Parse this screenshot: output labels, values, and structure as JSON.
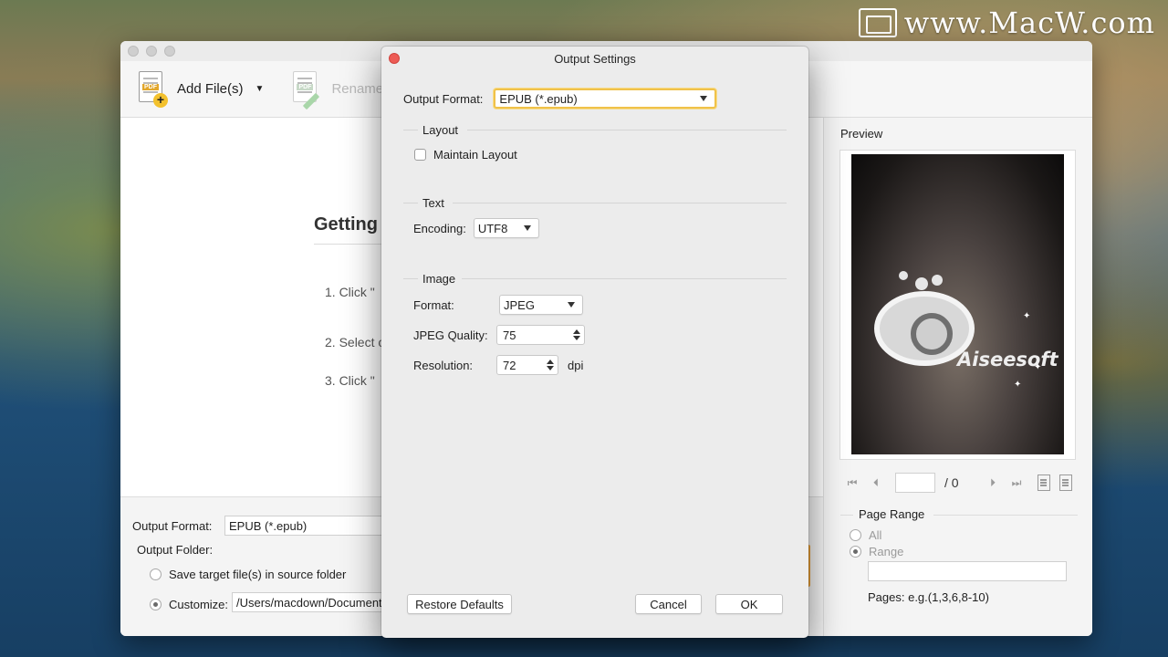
{
  "watermark": {
    "text": "www.MacW.com"
  },
  "toolbar": {
    "add_files_label": "Add File(s)",
    "rename_label": "Rename",
    "pdf_tag": "PDF"
  },
  "main": {
    "getting_started": "Getting",
    "steps": [
      "1. Click \"",
      "2. Select o",
      "3. Click \""
    ]
  },
  "bottom": {
    "output_format_label": "Output Format:",
    "output_format_value": "EPUB (*.epub)",
    "output_folder_label": "Output Folder:",
    "save_source_label": "Save target file(s) in source folder",
    "customize_label": "Customize:",
    "customize_path": "/Users/macdown/Documents"
  },
  "preview": {
    "title": "Preview",
    "logo_text": "Aiseesoft",
    "page_total": "/ 0",
    "page_range_title": "Page Range",
    "all_label": "All",
    "range_label": "Range",
    "pages_hint": "Pages: e.g.(1,3,6,8-10)"
  },
  "dialog": {
    "title": "Output Settings",
    "output_format_label": "Output Format:",
    "output_format_value": "EPUB (*.epub)",
    "layout": {
      "title": "Layout",
      "maintain_label": "Maintain Layout",
      "maintain_checked": false
    },
    "text": {
      "title": "Text",
      "encoding_label": "Encoding:",
      "encoding_value": "UTF8"
    },
    "image": {
      "title": "Image",
      "format_label": "Format:",
      "format_value": "JPEG",
      "quality_label": "JPEG Quality:",
      "quality_value": "75",
      "resolution_label": "Resolution:",
      "resolution_value": "72",
      "resolution_unit": "dpi"
    },
    "restore_label": "Restore Defaults",
    "cancel_label": "Cancel",
    "ok_label": "OK"
  }
}
